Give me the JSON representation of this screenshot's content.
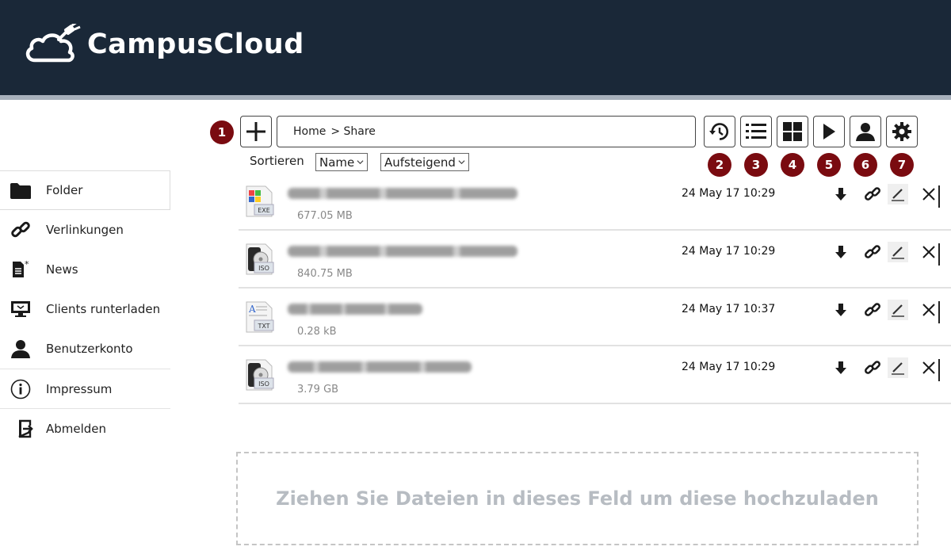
{
  "header": {
    "brand": "CampusCloud"
  },
  "sidebar": {
    "items": [
      {
        "label": "Folder",
        "icon": "folder-icon"
      },
      {
        "label": "Verlinkungen",
        "icon": "link-icon"
      },
      {
        "label": "News",
        "icon": "news-icon"
      },
      {
        "label": "Clients runterladen",
        "icon": "monitor-icon"
      },
      {
        "label": "Benutzerkonto",
        "icon": "user-icon"
      },
      {
        "label": "Impressum",
        "icon": "info-icon"
      },
      {
        "label": "Abmelden",
        "icon": "logout-icon"
      }
    ]
  },
  "toolbar": {
    "breadcrumb": [
      "Home",
      "> Share"
    ],
    "badges": [
      "1",
      "2",
      "3",
      "4",
      "5",
      "6",
      "7"
    ],
    "sort_label": "Sortieren",
    "sort_field": "Name",
    "sort_order": "Aufsteigend"
  },
  "files": [
    {
      "type": "EXE",
      "size": "677.05 MB",
      "date": "24 May 17 10:29"
    },
    {
      "type": "ISO",
      "size": "840.75 MB",
      "date": "24 May 17 10:29"
    },
    {
      "type": "TXT",
      "size": "0.28 kB",
      "date": "24 May 17 10:37"
    },
    {
      "type": "ISO",
      "size": "3.79 GB",
      "date": "24 May 17 10:29"
    }
  ],
  "dropzone": {
    "text": "Ziehen Sie Dateien in dieses Feld um diese hochzuladen"
  },
  "colors": {
    "header_bg": "#1a2838",
    "badge": "#7a0b10",
    "dropzone_text": "#b7bcc2"
  }
}
